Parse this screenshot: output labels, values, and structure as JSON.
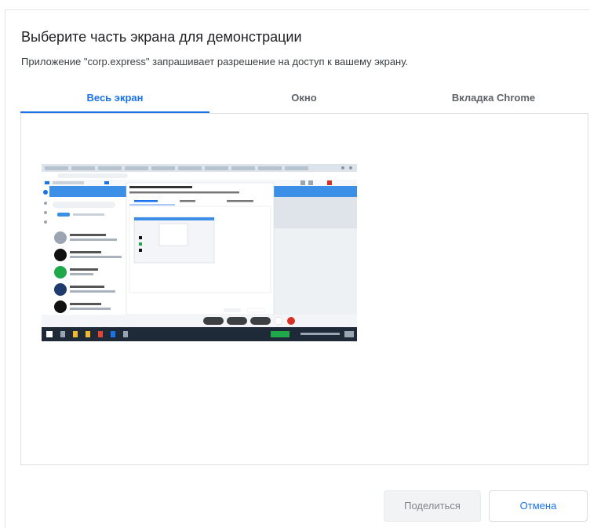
{
  "dialog": {
    "title": "Выберите часть экрана для демонстрации",
    "subtitle": "Приложение \"corp.express\" запрашивает разрешение на доступ к вашему экрану."
  },
  "tabs": [
    {
      "label": "Весь экран",
      "active": true
    },
    {
      "label": "Окно",
      "active": false
    },
    {
      "label": "Вкладка Chrome",
      "active": false
    }
  ],
  "buttons": {
    "share": "Поделиться",
    "cancel": "Отмена"
  },
  "colors": {
    "accent": "#1a73e8",
    "taskbar": "#1f2a38",
    "chat_header": "#3c8fe6"
  }
}
